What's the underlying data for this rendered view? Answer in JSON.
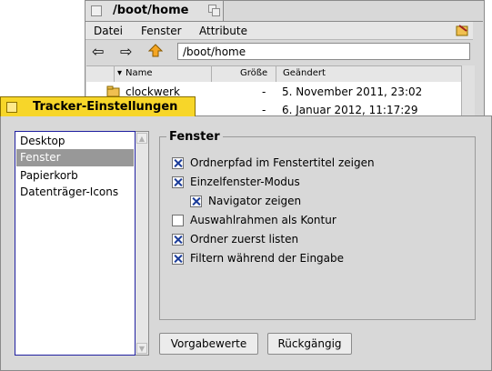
{
  "back_window": {
    "title": "/boot/home",
    "menu": [
      "Datei",
      "Fenster",
      "Attribute"
    ],
    "path_value": "/boot/home",
    "columns": [
      "Name",
      "Größe",
      "Geändert"
    ],
    "rows": [
      {
        "name": "clockwerk",
        "size": "-",
        "modified": "5. November 2011, 23:02"
      },
      {
        "name": "",
        "size": "-",
        "modified": "6. Januar 2012, 11:17:29"
      }
    ],
    "icons": [
      "back-arrow-icon",
      "forward-arrow-icon",
      "up-arrow-icon",
      "tracker-menu-icon",
      "folder-icon"
    ]
  },
  "front_window": {
    "title": "Tracker-Einstellungen",
    "categories": [
      "Desktop",
      "Fenster",
      "Papierkorb",
      "Datenträger-Icons"
    ],
    "selected_category": "Fenster",
    "group_title": "Fenster",
    "options": [
      {
        "label": "Ordnerpfad im Fenstertitel zeigen",
        "checked": true
      },
      {
        "label": "Einzelfenster-Modus",
        "checked": true
      },
      {
        "label": "Navigator zeigen",
        "checked": true
      },
      {
        "label": "Auswahlrahmen als Kontur",
        "checked": false
      },
      {
        "label": "Ordner zuerst listen",
        "checked": true
      },
      {
        "label": "Filtern während der Eingabe",
        "checked": true
      }
    ],
    "buttons": {
      "defaults": "Vorgabewerte",
      "revert": "Rückgängig"
    },
    "colors": {
      "active_tab": "#f7d629",
      "selection": "#989898",
      "check": "#1c3d9a"
    }
  }
}
